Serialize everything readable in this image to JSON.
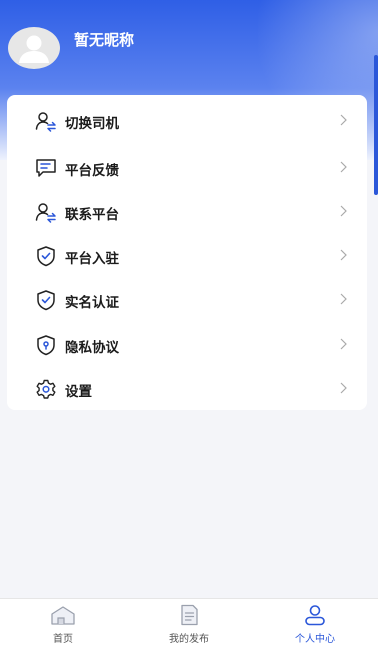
{
  "profile": {
    "nickname": "暂无昵称"
  },
  "menu": [
    {
      "label": "切换司机",
      "icon": "switch-driver-icon"
    },
    {
      "label": "平台反馈",
      "icon": "feedback-icon"
    },
    {
      "label": "联系平台",
      "icon": "contact-platform-icon"
    },
    {
      "label": "平台入驻",
      "icon": "shield-check-icon"
    },
    {
      "label": "实名认证",
      "icon": "shield-check-icon"
    },
    {
      "label": "隐私协议",
      "icon": "privacy-shield-icon"
    },
    {
      "label": "设置",
      "icon": "gear-icon"
    }
  ],
  "tabs": [
    {
      "label": "首页",
      "icon": "home-icon",
      "active": false
    },
    {
      "label": "我的发布",
      "icon": "document-icon",
      "active": false
    },
    {
      "label": "个人中心",
      "icon": "user-icon",
      "active": true
    }
  ],
  "colors": {
    "accent": "#2b57d9",
    "header_top": "#2f5fe6",
    "background": "#f4f5f9"
  }
}
